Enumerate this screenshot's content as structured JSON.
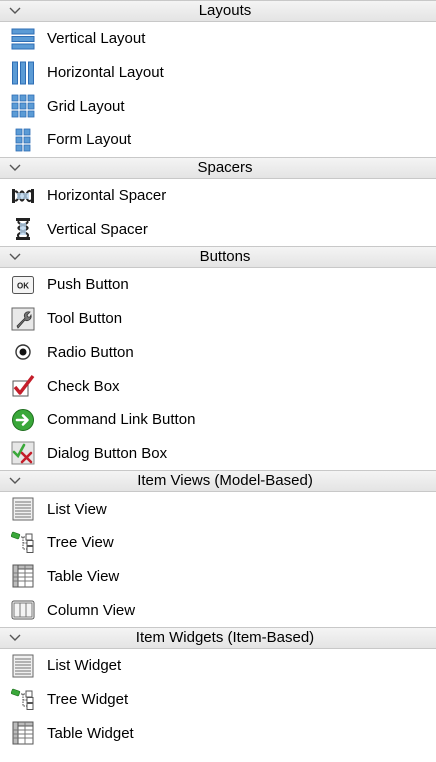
{
  "categories": [
    {
      "title": "Layouts",
      "items": [
        {
          "label": "Vertical Layout",
          "icon": "vertical-layout-icon"
        },
        {
          "label": "Horizontal Layout",
          "icon": "horizontal-layout-icon"
        },
        {
          "label": "Grid Layout",
          "icon": "grid-layout-icon"
        },
        {
          "label": "Form Layout",
          "icon": "form-layout-icon"
        }
      ]
    },
    {
      "title": "Spacers",
      "items": [
        {
          "label": "Horizontal Spacer",
          "icon": "horizontal-spacer-icon"
        },
        {
          "label": "Vertical Spacer",
          "icon": "vertical-spacer-icon"
        }
      ]
    },
    {
      "title": "Buttons",
      "items": [
        {
          "label": "Push Button",
          "icon": "push-button-icon"
        },
        {
          "label": "Tool Button",
          "icon": "tool-button-icon"
        },
        {
          "label": "Radio Button",
          "icon": "radio-button-icon"
        },
        {
          "label": "Check Box",
          "icon": "check-box-icon"
        },
        {
          "label": "Command Link Button",
          "icon": "command-link-button-icon"
        },
        {
          "label": "Dialog Button Box",
          "icon": "dialog-button-box-icon"
        }
      ]
    },
    {
      "title": "Item Views (Model-Based)",
      "items": [
        {
          "label": "List View",
          "icon": "list-view-icon"
        },
        {
          "label": "Tree View",
          "icon": "tree-view-icon"
        },
        {
          "label": "Table View",
          "icon": "table-view-icon"
        },
        {
          "label": "Column View",
          "icon": "column-view-icon"
        }
      ]
    },
    {
      "title": "Item Widgets (Item-Based)",
      "items": [
        {
          "label": "List Widget",
          "icon": "list-widget-icon"
        },
        {
          "label": "Tree Widget",
          "icon": "tree-widget-icon"
        },
        {
          "label": "Table Widget",
          "icon": "table-widget-icon"
        }
      ]
    }
  ],
  "colors": {
    "header_bg": "#ececec",
    "layout_blue": "#3a78c8",
    "check_red": "#c41e2a",
    "command_green": "#3aa83a"
  },
  "icons": {
    "chevron": "chevron-down-icon"
  }
}
